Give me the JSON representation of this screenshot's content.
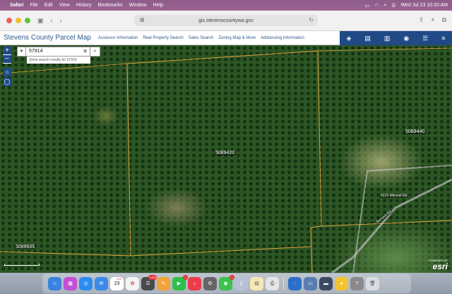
{
  "menubar": {
    "app": "Safari",
    "items": [
      "File",
      "Edit",
      "View",
      "History",
      "Bookmarks",
      "Window",
      "Help"
    ],
    "clock": "Wed Jul 23  10:20 AM"
  },
  "browser": {
    "url": "gis.stevenscountywa.gov"
  },
  "app": {
    "title": "Stevens County Parcel Map",
    "nav": [
      "Assessor Information",
      "Real Property Search",
      "Sales Search",
      "Zoning Map & More",
      "Addressing Information"
    ]
  },
  "search": {
    "value": "57914",
    "suggestion": "Show search results for 57914"
  },
  "map": {
    "parcels": [
      {
        "id": "5089420"
      },
      {
        "id": "5089440"
      },
      {
        "id": "5089605"
      }
    ],
    "road_label": "4315 Mitchell Rd",
    "road_label2": "Bernard Rd",
    "attribution_top": "POWERED BY",
    "attribution": "esri"
  },
  "dock": {
    "calendar_day": "23",
    "calendar_month": "JUL",
    "badges": {
      "mail": "1,806",
      "facetime": "1",
      "messages": "1"
    }
  },
  "colors": {
    "brand_blue": "#1f4a86",
    "title_blue": "#2c5a8c",
    "parcel_line": "#e0a43a"
  }
}
